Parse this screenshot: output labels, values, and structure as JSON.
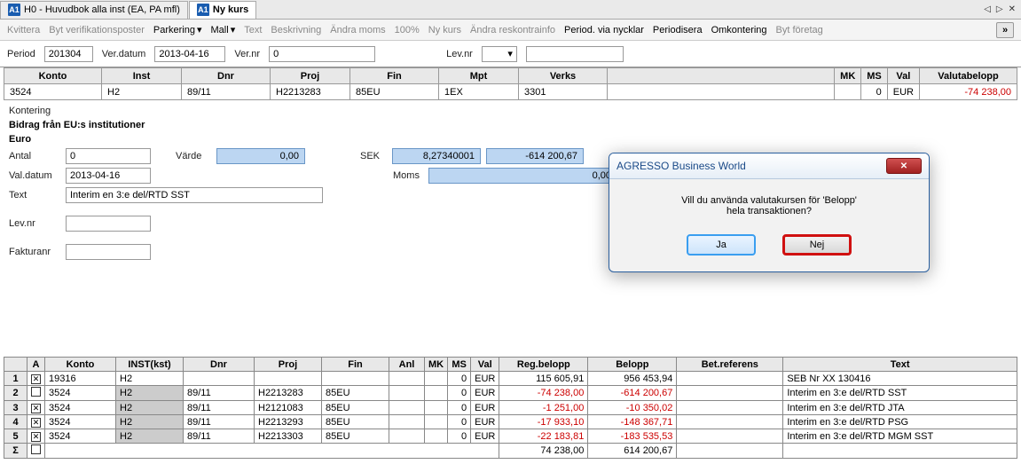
{
  "tabs": {
    "tab0": {
      "icon": "A1",
      "label": "H0 - Huvudbok alla inst (EA, PA mfl)"
    },
    "tab1": {
      "icon": "A1",
      "label": "Ny kurs"
    }
  },
  "menubar": {
    "items": [
      "Kvittera",
      "Byt verifikationsposter",
      "Parkering",
      "Mall",
      "Text",
      "Beskrivning",
      "Ändra moms",
      "100%",
      "Ny kurs",
      "Ändra reskontrainfo",
      "Period. via nycklar",
      "Periodisera",
      "Omkontering",
      "Byt företag"
    ],
    "more": "»"
  },
  "filters": {
    "period_label": "Period",
    "period": "201304",
    "verdatum_label": "Ver.datum",
    "verdatum": "2013-04-16",
    "vernr_label": "Ver.nr",
    "vernr": "0",
    "levnr_label": "Lev.nr"
  },
  "topgrid": {
    "headers": [
      "Konto",
      "Inst",
      "Dnr",
      "Proj",
      "Fin",
      "Mpt",
      "Verks",
      "",
      "MK",
      "MS",
      "Val",
      "Valutabelopp"
    ],
    "row": {
      "konto": "3524",
      "inst": "H2",
      "dnr": "89/11",
      "proj": "H2213283",
      "fin": "85EU",
      "mpt": "1EX",
      "verks": "3301",
      "blank": "",
      "mk": "",
      "ms": "0",
      "val": "EUR",
      "belopp": "-74 238,00"
    }
  },
  "kontering": {
    "title": "Kontering",
    "line1": "Bidrag från EU:s institutioner",
    "line2": "Euro",
    "antal_label": "Antal",
    "antal": "0",
    "varde_label": "Värde",
    "varde": "0,00",
    "sek_label": "SEK",
    "sek_rate": "8,27340001",
    "sek_amount": "-614 200,67",
    "valdatum_label": "Val.datum",
    "valdatum": "2013-04-16",
    "moms_label": "Moms",
    "moms": "0,00",
    "text_label": "Text",
    "text": "Interim en 3:e del/RTD SST",
    "levnr_label": "Lev.nr",
    "fakturanr_label": "Fakturanr"
  },
  "dialog": {
    "title": "AGRESSO Business World",
    "line1": "Vill du använda valutakursen för 'Belopp'",
    "line2": "hela transaktionen?",
    "ja": "Ja",
    "nej": "Nej"
  },
  "bgrid": {
    "headers": [
      "",
      "A",
      "Konto",
      "INST(kst)",
      "Dnr",
      "Proj",
      "Fin",
      "Anl",
      "MK",
      "MS",
      "Val",
      "Reg.belopp",
      "Belopp",
      "Bet.referens",
      "Text"
    ],
    "rows": [
      {
        "num": "1",
        "a": true,
        "konto": "19316",
        "inst": "H2",
        "inst_grey": false,
        "dnr": "",
        "proj": "",
        "fin": "",
        "anl": "",
        "mk": "",
        "ms": "0",
        "val": "EUR",
        "reg": "115 605,91",
        "reg_neg": false,
        "bel": "956 453,94",
        "bel_neg": false,
        "betref": "",
        "text": "SEB Nr XX 130416"
      },
      {
        "num": "2",
        "a": false,
        "konto": "3524",
        "inst": "H2",
        "inst_grey": true,
        "dnr": "89/11",
        "proj": "H2213283",
        "fin": "85EU",
        "anl": "",
        "mk": "",
        "ms": "0",
        "val": "EUR",
        "reg": "-74 238,00",
        "reg_neg": true,
        "bel": "-614 200,67",
        "bel_neg": true,
        "betref": "",
        "text": "Interim en 3:e del/RTD SST"
      },
      {
        "num": "3",
        "a": true,
        "konto": "3524",
        "inst": "H2",
        "inst_grey": true,
        "dnr": "89/11",
        "proj": "H2121083",
        "fin": "85EU",
        "anl": "",
        "mk": "",
        "ms": "0",
        "val": "EUR",
        "reg": "-1 251,00",
        "reg_neg": true,
        "bel": "-10 350,02",
        "bel_neg": true,
        "betref": "",
        "text": "Interim en 3:e del/RTD JTA"
      },
      {
        "num": "4",
        "a": true,
        "konto": "3524",
        "inst": "H2",
        "inst_grey": true,
        "dnr": "89/11",
        "proj": "H2213293",
        "fin": "85EU",
        "anl": "",
        "mk": "",
        "ms": "0",
        "val": "EUR",
        "reg": "-17 933,10",
        "reg_neg": true,
        "bel": "-148 367,71",
        "bel_neg": true,
        "betref": "",
        "text": "Interim en 3:e del/RTD PSG"
      },
      {
        "num": "5",
        "a": true,
        "konto": "3524",
        "inst": "H2",
        "inst_grey": true,
        "dnr": "89/11",
        "proj": "H2213303",
        "fin": "85EU",
        "anl": "",
        "mk": "",
        "ms": "0",
        "val": "EUR",
        "reg": "-22 183,81",
        "reg_neg": true,
        "bel": "-183 535,53",
        "bel_neg": true,
        "betref": "",
        "text": "Interim en 3:e del/RTD MGM SST"
      }
    ],
    "sumsym": "Σ",
    "sum_reg": "74 238,00",
    "sum_bel": "614 200,67"
  }
}
